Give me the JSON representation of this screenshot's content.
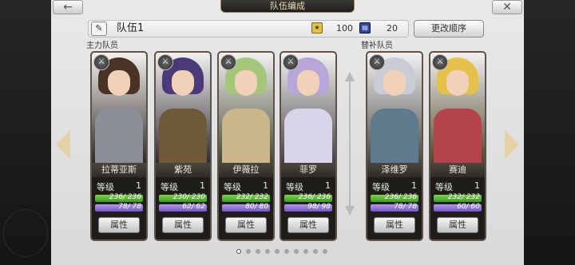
{
  "window": {
    "title": "队伍编成"
  },
  "nav": {
    "back_glyph": "←",
    "close_glyph": "✕"
  },
  "party": {
    "edit_icon": "pencil-icon",
    "name": "队伍1",
    "stat_a": {
      "icon": "gold-badge-icon",
      "value": "100"
    },
    "stat_b": {
      "icon": "blue-badge-icon",
      "value": "20"
    },
    "reorder_label": "更改顺序"
  },
  "sections": {
    "main": "主力队员",
    "sub": "替补队员"
  },
  "labels": {
    "level": "等级",
    "attr": "属性"
  },
  "members": [
    {
      "name": "拉蒂亚斯",
      "level": "1",
      "hp": "236/ 236",
      "mp": "78/ 78",
      "role_icon": "sword-class-icon",
      "hair": "#4a3226",
      "armor": "#8a8f99"
    },
    {
      "name": "紫苑",
      "level": "1",
      "hp": "230/ 230",
      "mp": "62/ 62",
      "role_icon": "sword-class-icon",
      "hair": "#4a3a78",
      "armor": "#6d5a3a"
    },
    {
      "name": "伊薇拉",
      "level": "1",
      "hp": "232/ 232",
      "mp": "80/ 80",
      "role_icon": "bow-class-icon",
      "hair": "#a4c77a",
      "armor": "#c9b78a"
    },
    {
      "name": "菲罗",
      "level": "1",
      "hp": "236/ 236",
      "mp": "98/ 98",
      "role_icon": "magic-class-icon",
      "hair": "#b7a7d8",
      "armor": "#d9d4e8"
    },
    {
      "name": "泽维罗",
      "level": "1",
      "hp": "236/ 236",
      "mp": "78/ 78",
      "role_icon": "magic-class-icon",
      "hair": "#c9ccd4",
      "armor": "#5f7a8a"
    },
    {
      "name": "赛迪",
      "level": "1",
      "hp": "232/ 232",
      "mp": "60/ 60",
      "role_icon": "sword-class-icon",
      "hair": "#e4c24a",
      "armor": "#b4444a"
    }
  ],
  "pagination": {
    "pages": 10,
    "current": 0
  },
  "colors": {
    "hp": "#5db83a",
    "mp": "#8b6ad6",
    "arrow": "#e5d2a6"
  }
}
